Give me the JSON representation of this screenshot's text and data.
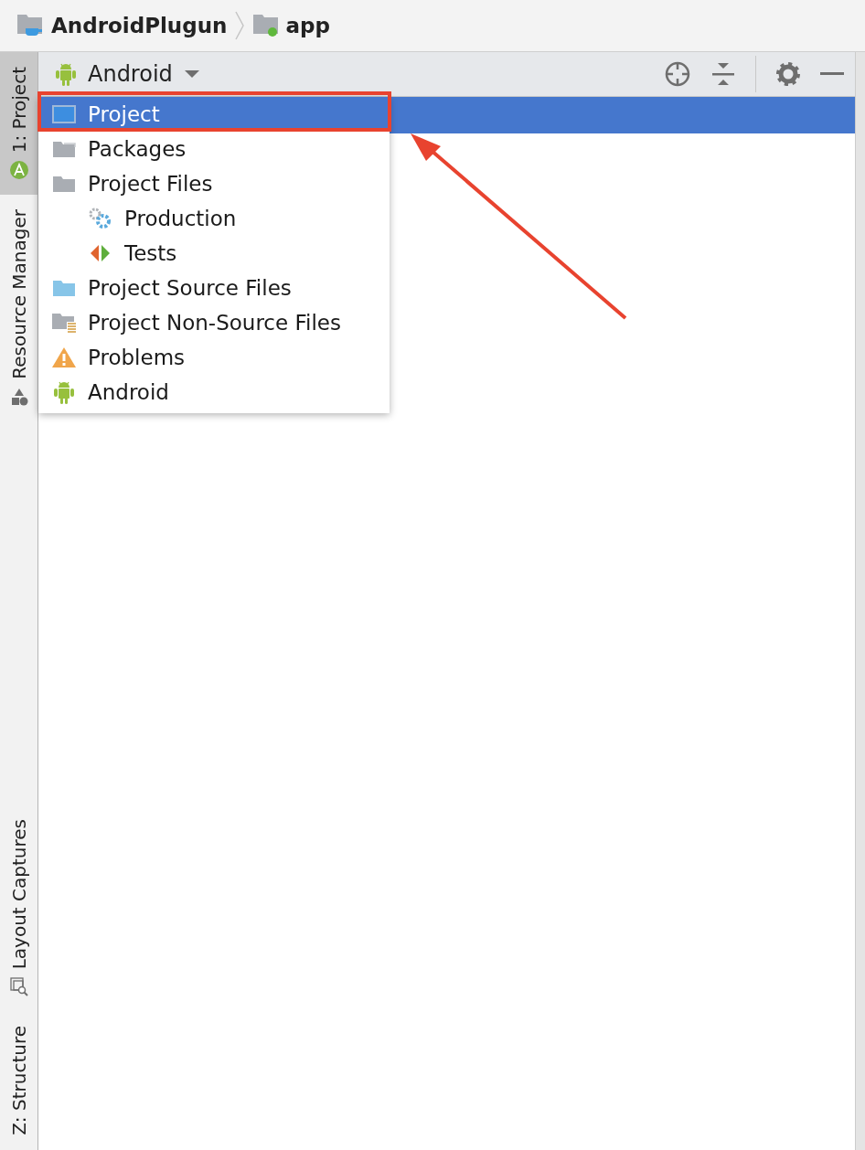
{
  "breadcrumb": [
    {
      "label": "AndroidPlugun",
      "kind": "project"
    },
    {
      "label": "app",
      "kind": "module"
    }
  ],
  "tool_tabs": [
    {
      "label": "1: Project",
      "kind": "project",
      "selected": true
    },
    {
      "label": "Resource Manager",
      "kind": "resources",
      "selected": false
    },
    {
      "label": "Layout Captures",
      "kind": "captures",
      "selected": false
    },
    {
      "label": "Z: Structure",
      "kind": "structure",
      "selected": false
    }
  ],
  "view_selector": {
    "label": "Android"
  },
  "view_menu": [
    {
      "label": "Project",
      "kind": "project",
      "selected": true
    },
    {
      "label": "Packages",
      "kind": "packages",
      "selected": false
    },
    {
      "label": "Project Files",
      "kind": "folder",
      "selected": false,
      "children": [
        {
          "label": "Production",
          "kind": "production",
          "selected": false
        },
        {
          "label": "Tests",
          "kind": "tests",
          "selected": false
        }
      ]
    },
    {
      "label": "Project Source Files",
      "kind": "source",
      "selected": false
    },
    {
      "label": "Project Non-Source Files",
      "kind": "nonsource",
      "selected": false
    },
    {
      "label": "Problems",
      "kind": "problems",
      "selected": false
    },
    {
      "label": "Android",
      "kind": "android",
      "selected": false
    }
  ]
}
